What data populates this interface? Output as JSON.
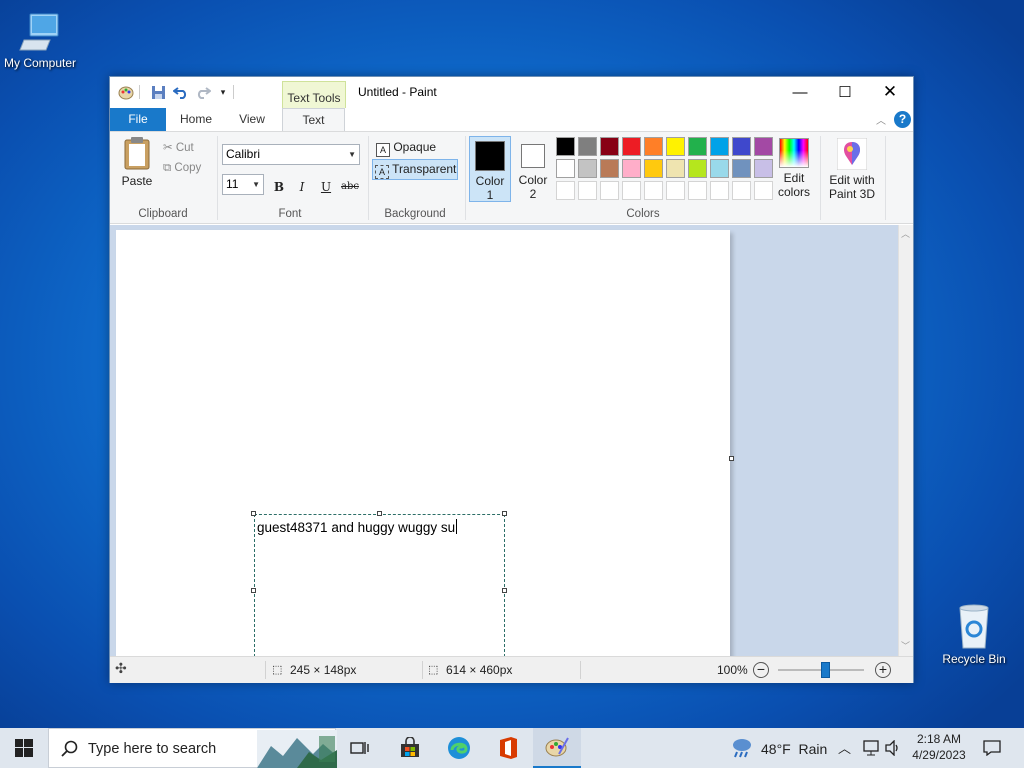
{
  "desktop": {
    "my_computer": "My Computer",
    "recycle_bin": "Recycle Bin"
  },
  "window": {
    "title": "Untitled - Paint",
    "context_tab": "Text Tools"
  },
  "tabs": {
    "file": "File",
    "home": "Home",
    "view": "View",
    "text": "Text"
  },
  "clipboard": {
    "paste": "Paste",
    "cut": "Cut",
    "copy": "Copy",
    "label": "Clipboard"
  },
  "font": {
    "family": "Calibri",
    "size": "11",
    "bold": "B",
    "italic": "I",
    "underline": "U",
    "strike": "abc",
    "label": "Font"
  },
  "background": {
    "opaque": "Opaque",
    "transparent": "Transparent",
    "label": "Background",
    "selected": "Transparent"
  },
  "colors": {
    "color1_line1": "Color",
    "color1_line2": "1",
    "color2_line1": "Color",
    "color2_line2": "2",
    "color1_value": "#000000",
    "color2_value": "#ffffff",
    "palette_row1": [
      "#000000",
      "#7f7f7f",
      "#880015",
      "#ed1c24",
      "#ff7f27",
      "#fff200",
      "#22b14c",
      "#00a2e8",
      "#3f48cc",
      "#a349a4"
    ],
    "palette_row2": [
      "#ffffff",
      "#c3c3c3",
      "#b97a57",
      "#ffaec9",
      "#ffc90e",
      "#efe4b0",
      "#b5e61d",
      "#99d9ea",
      "#7092be",
      "#c8bfe7"
    ],
    "edit_line1": "Edit",
    "edit_line2": "colors",
    "label": "Colors"
  },
  "paint3d": {
    "line1": "Edit with",
    "line2": "Paint 3D"
  },
  "canvas": {
    "text": "guest48371 and huggy wuggy su"
  },
  "status": {
    "selection": "245 × 148px",
    "size": "614 × 460px",
    "zoom": "100%",
    "zoom_fraction": 0.55
  },
  "taskbar": {
    "search_placeholder": "Type here to search",
    "weather_temp": "48°F",
    "weather_desc": "Rain",
    "time": "2:18 AM",
    "date": "4/29/2023"
  }
}
